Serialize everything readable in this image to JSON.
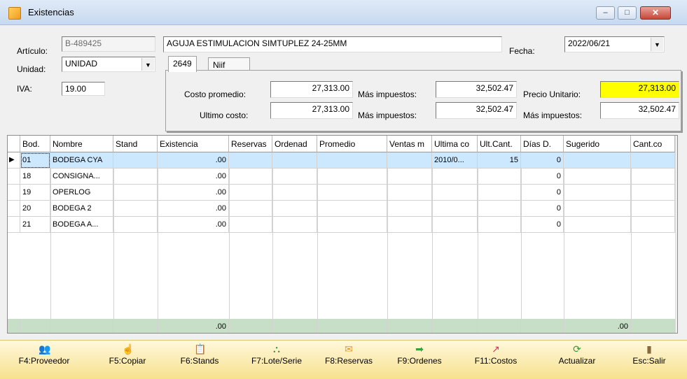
{
  "window": {
    "title": "Existencias",
    "minimize": "–",
    "maximize": "□",
    "close": "✕"
  },
  "form": {
    "articulo_label": "Artículo:",
    "articulo_code": "B-489425",
    "articulo_desc": "AGUJA ESTIMULACION SIMTUPLEZ 24-25MM",
    "fecha_label": "Fecha:",
    "fecha_value": "2022/06/21",
    "unidad_label": "Unidad:",
    "unidad_value": "UNIDAD",
    "iva_label": "IVA:",
    "iva_value": "19.00"
  },
  "tabs": [
    "2649",
    "Niif"
  ],
  "costs": {
    "costo_promedio_label": "Costo promedio:",
    "costo_promedio": "27,313.00",
    "mas_impuestos_label": "Más impuestos:",
    "mas_impuestos_1": "32,502.47",
    "precio_unitario_label": "Precio Unitario:",
    "precio_unitario": "27,313.00",
    "ultimo_costo_label": "Ultimo costo:",
    "ultimo_costo": "27,313.00",
    "mas_impuestos_2": "32,502.47",
    "mas_impuestos_3": "32,502.47",
    "highlight_color": "#ffff00"
  },
  "grid": {
    "columns": [
      "Bod.",
      "Nombre",
      "Stand",
      "Existencia",
      "Reservas",
      "Ordenad",
      "Promedio",
      "Ventas m",
      "Ultima co",
      "Ult.Cant.",
      "Días D.",
      "Sugerido",
      "Cant.co"
    ],
    "rows": [
      [
        "01",
        "BODEGA CYA",
        "",
        ".00",
        "",
        "",
        "",
        "",
        "2010/0...",
        "15",
        "0",
        "",
        ""
      ],
      [
        "18",
        "CONSIGNA...",
        "",
        ".00",
        "",
        "",
        "",
        "",
        "",
        "",
        "0",
        "",
        ""
      ],
      [
        "19",
        "OPERLOG",
        "",
        ".00",
        "",
        "",
        "",
        "",
        "",
        "",
        "0",
        "",
        ""
      ],
      [
        "20",
        "BODEGA 2",
        "",
        ".00",
        "",
        "",
        "",
        "",
        "",
        "",
        "0",
        "",
        ""
      ],
      [
        "21",
        "BODEGA A...",
        "",
        ".00",
        "",
        "",
        "",
        "",
        "",
        "",
        "0",
        "",
        ""
      ]
    ],
    "totals": [
      "",
      "",
      "",
      ".00",
      "",
      "",
      "",
      "",
      "",
      "",
      "",
      ".00",
      ""
    ],
    "selected_color": "#cce8ff",
    "totals_color": "#c6dfc6"
  },
  "toolbar": {
    "buttons": [
      {
        "label": "F4:Proveedor",
        "icon": "users-icon"
      },
      {
        "label": "F5:Copiar",
        "icon": "hand-icon"
      },
      {
        "label": "F6:Stands",
        "icon": "clipboard-icon"
      },
      {
        "label": "F7:Lote/Serie",
        "icon": "hierarchy-icon"
      },
      {
        "label": "F8:Reservas",
        "icon": "reserve-icon"
      },
      {
        "label": "F9:Ordenes",
        "icon": "order-icon"
      },
      {
        "label": "F11:Costos",
        "icon": "chart-icon"
      },
      {
        "label": "Actualizar",
        "icon": "refresh-icon"
      },
      {
        "label": "Esc:Salir",
        "icon": "exit-icon"
      }
    ]
  }
}
